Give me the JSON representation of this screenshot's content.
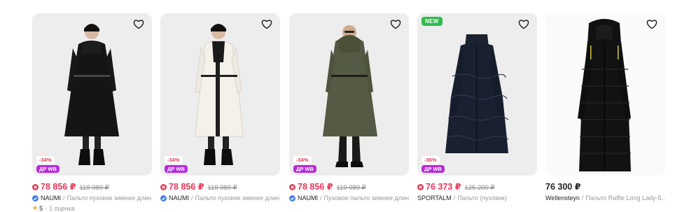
{
  "products": [
    {
      "new_badge": "",
      "discount": "-34%",
      "promo": "ДР WB",
      "price": "78 856 ₽",
      "old_price": "119 989 ₽",
      "brand": "NAUMI",
      "separator": "/",
      "description": "Пальто пуховик зимнее длин...",
      "rating": "5",
      "reviews": "1 оценка"
    },
    {
      "new_badge": "",
      "discount": "-34%",
      "promo": "ДР WB",
      "price": "78 856 ₽",
      "old_price": "119 989 ₽",
      "brand": "NAUMI",
      "separator": "/",
      "description": "Пальто пуховик зимнее длин..."
    },
    {
      "new_badge": "",
      "discount": "-34%",
      "promo": "ДР WB",
      "price": "78 856 ₽",
      "old_price": "119 989 ₽",
      "brand": "NAUMI",
      "separator": "/",
      "description": "Пуховое пальто зимнее длин..."
    },
    {
      "new_badge": "NEW",
      "discount": "-36%",
      "promo": "ДР WB",
      "price": "76 373 ₽",
      "old_price": "125 200 ₽",
      "brand": "SPORTALM",
      "separator": "/",
      "description": "Пальто (пуховик)"
    },
    {
      "new_badge": "",
      "price": "76 300 ₽",
      "old_price": "",
      "brand": "Wellensteyn",
      "separator": "/",
      "description": "Пальто Raffle Long Lady-5..."
    }
  ],
  "icons": {
    "favorite": "heart-outline-icon",
    "price_mark": "wb-wallet-icon",
    "verified": "verified-check-icon",
    "rating": "star-icon"
  },
  "colors": {
    "price_red": "#e33a57",
    "promo_purple": "#b42cd9",
    "new_green": "#31b94d",
    "verified_blue": "#4a7fe8",
    "star": "#f5a623"
  }
}
